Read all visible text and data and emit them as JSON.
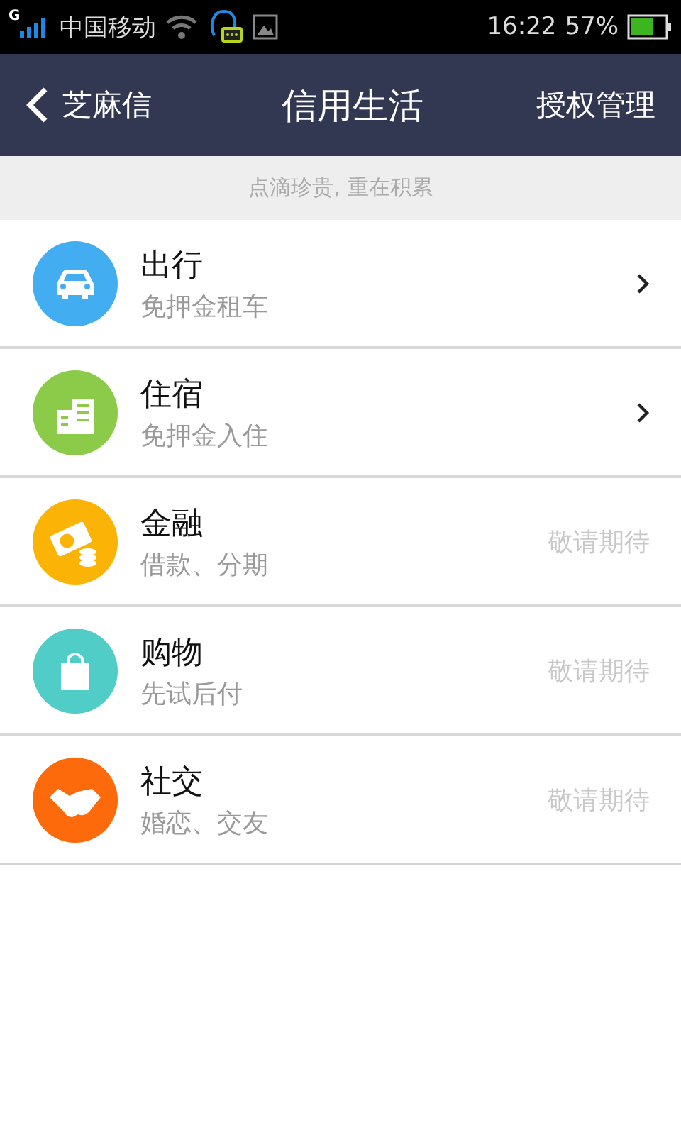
{
  "status_bar": {
    "network": "G",
    "carrier": "中国移动",
    "time": "16:22",
    "battery": "57%"
  },
  "nav": {
    "back": "芝麻信",
    "title": "信用生活",
    "action": "授权管理"
  },
  "banner": "点滴珍贵, 重在积累",
  "items": [
    {
      "title": "出行",
      "subtitle": "免押金租车",
      "kind": "link",
      "color": "#43adf2"
    },
    {
      "title": "住宿",
      "subtitle": "免押金入住",
      "kind": "link",
      "color": "#8ccb49"
    },
    {
      "title": "金融",
      "subtitle": "借款、分期",
      "kind": "soon",
      "status": "敬请期待",
      "color": "#fbb406"
    },
    {
      "title": "购物",
      "subtitle": "先试后付",
      "kind": "soon",
      "status": "敬请期待",
      "color": "#4fcdc6"
    },
    {
      "title": "社交",
      "subtitle": "婚恋、交友",
      "kind": "soon",
      "status": "敬请期待",
      "color": "#fc6a0b"
    }
  ]
}
